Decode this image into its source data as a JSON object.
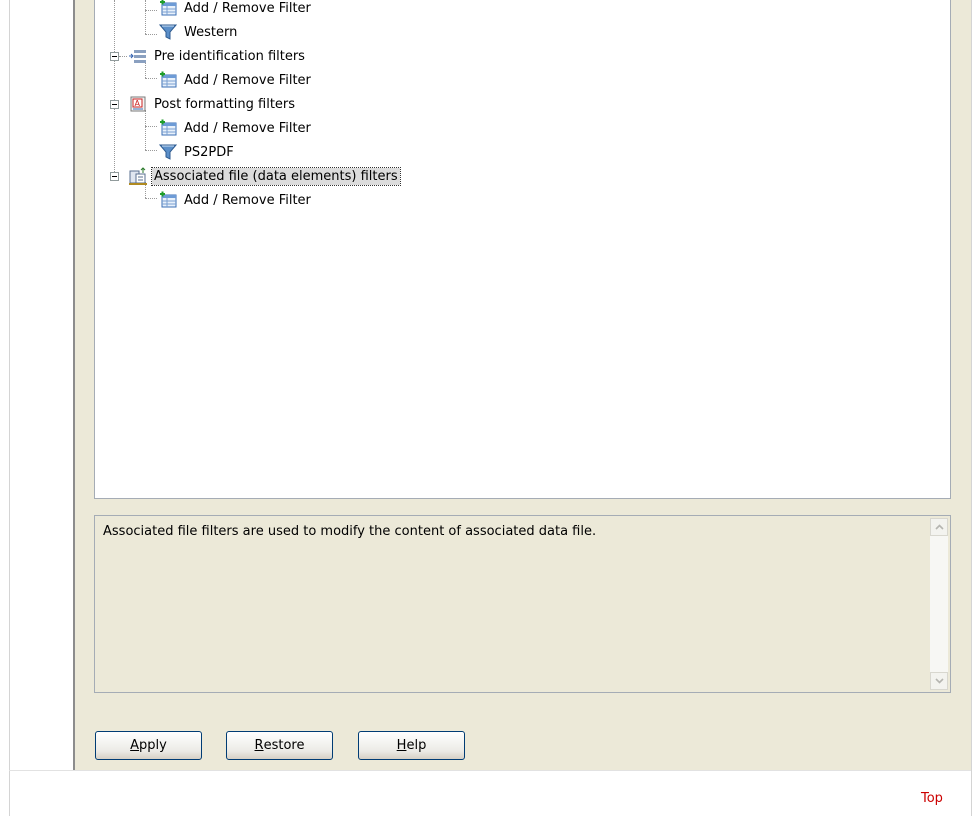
{
  "tree": {
    "nodes": [
      {
        "label": "Add / Remove Filter",
        "icon": "add-remove-filter-icon"
      },
      {
        "label": "Western",
        "icon": "funnel-filter-icon"
      },
      {
        "label": "Pre identification filters",
        "icon": "pre-identification-icon"
      },
      {
        "label": "Add / Remove Filter",
        "icon": "add-remove-filter-icon"
      },
      {
        "label": "Post formatting filters",
        "icon": "post-formatting-icon"
      },
      {
        "label": "Add / Remove Filter",
        "icon": "add-remove-filter-icon"
      },
      {
        "label": "PS2PDF",
        "icon": "funnel-filter-icon"
      },
      {
        "label": "Associated file (data elements) filters",
        "icon": "associated-file-icon",
        "selected": true
      },
      {
        "label": "Add / Remove Filter",
        "icon": "add-remove-filter-icon"
      }
    ]
  },
  "description": {
    "text": "Associated file filters are used to modify the content of associated data file."
  },
  "buttons": {
    "apply": {
      "first": "A",
      "rest": "pply"
    },
    "restore": {
      "first": "R",
      "rest": "estore"
    },
    "help": {
      "first": "H",
      "rest": "elp"
    }
  },
  "footer": {
    "top_link": "Top"
  },
  "colors": {
    "dialog_bg": "#ece9d8",
    "selection": "#dcdcdc",
    "link": "#cc0000"
  }
}
